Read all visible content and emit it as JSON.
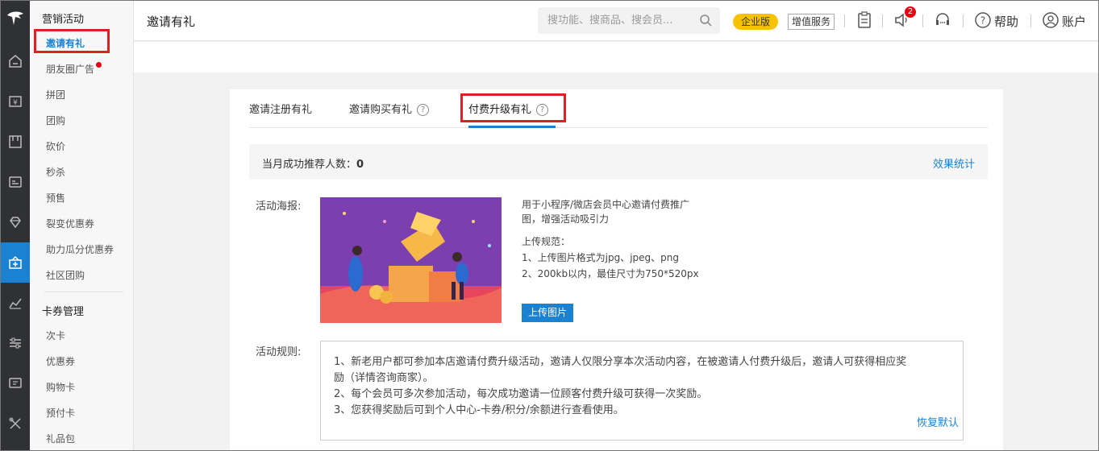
{
  "sidebar": {
    "groups": [
      {
        "label": "营销活动",
        "items": [
          "邀请有礼",
          "朋友圈广告",
          "拼团",
          "团购",
          "砍价",
          "秒杀",
          "预售",
          "裂变优惠券",
          "助力瓜分优惠券",
          "社区团购"
        ]
      },
      {
        "label": "卡券管理",
        "items": [
          "次卡",
          "优惠券",
          "购物卡",
          "预付卡",
          "礼品包"
        ]
      }
    ],
    "active_item": "邀请有礼"
  },
  "topbar": {
    "title": "邀请有礼",
    "search_placeholder": "搜功能、搜商品、搜会员...",
    "enterprise_badge": "企业版",
    "value_added": "增值服务",
    "notification_count": "2",
    "help": "帮助",
    "account": "账户"
  },
  "tabs": [
    {
      "label": "邀请注册有礼",
      "help": false
    },
    {
      "label": "邀请购买有礼",
      "help": true
    },
    {
      "label": "付费升级有礼",
      "help": true,
      "active": true
    }
  ],
  "stats": {
    "label": "当月成功推荐人数：",
    "value": "0",
    "link": "效果统计"
  },
  "poster": {
    "label": "活动海报:",
    "desc_line1": "用于小程序/微店会员中心邀请付费推广",
    "desc_line2": "图，增强活动吸引力",
    "spec_title": "上传规范：",
    "spec_1": "1、上传图片格式为jpg、jpeg、png",
    "spec_2": "2、200kb以内，最佳尺寸为750*520px",
    "upload_button": "上传图片"
  },
  "rules": {
    "label": "活动规则:",
    "line1": "1、新老用户都可参加本店邀请付费升级活动，邀请人仅限分享本次活动内容，在被邀请人付费升级后，邀请人可获得相应奖",
    "line1b": "励（详情咨询商家）。",
    "line2": "2、每个会员可多次参加活动，每次成功邀请一位顾客付费升级可获得一次奖励。",
    "line3": "3、您获得奖励后可到个人中心-卡券/积分/余额进行查看使用。",
    "restore": "恢复默认"
  },
  "colors": {
    "accent": "#1b82d2",
    "rail_bg": "#2f3134",
    "badge_yellow": "#f7c200",
    "highlight_red": "#e02020"
  }
}
